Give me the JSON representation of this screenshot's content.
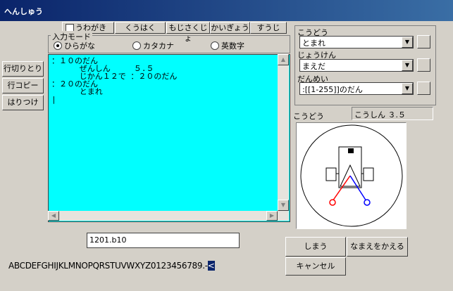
{
  "window": {
    "title": "へんしゅう"
  },
  "tabs": [
    {
      "label": "うわがき"
    },
    {
      "label": "くうはく"
    },
    {
      "label": "もじさくじょ"
    },
    {
      "label": "かいぎょう"
    },
    {
      "label": "すうじ"
    }
  ],
  "input_mode": {
    "label": "入力モード",
    "options": [
      "ひらがな",
      "カタカナ",
      "英数字"
    ],
    "selected": "ひらがな"
  },
  "side_buttons": [
    "行切りとり",
    "行コピー",
    "はりつけ"
  ],
  "editor": {
    "lines": [
      "：１０のだん",
      "      ぜんしん     ５.５",
      "      じかん１２で ：２０のだん",
      "：２０のだん",
      "      とまれ",
      "|"
    ]
  },
  "filename": {
    "value": "1201.b10"
  },
  "alphabet": {
    "text": "ABCDEFGHIJKLMNOPQRSTUVWXYZ0123456789.-",
    "cursor": "<"
  },
  "right_panel": {
    "behavior_label": "こうどう",
    "behavior_value": "とまれ",
    "condition_label": "じょうけん",
    "condition_value": "まえだ",
    "stage_label": "だんめい",
    "stage_value": ":[[1-255]]のだん",
    "action_label": "こうどう",
    "action_value": "こうしん ３.５"
  },
  "buttons": {
    "save": "しまう",
    "rename": "なまえをかえる",
    "cancel": "キャンセル"
  },
  "colors": {
    "editor_bg": "#00ffff",
    "title_bg": "#0a246a",
    "wheel_left": "#ff0000",
    "wheel_right": "#0000ff"
  }
}
